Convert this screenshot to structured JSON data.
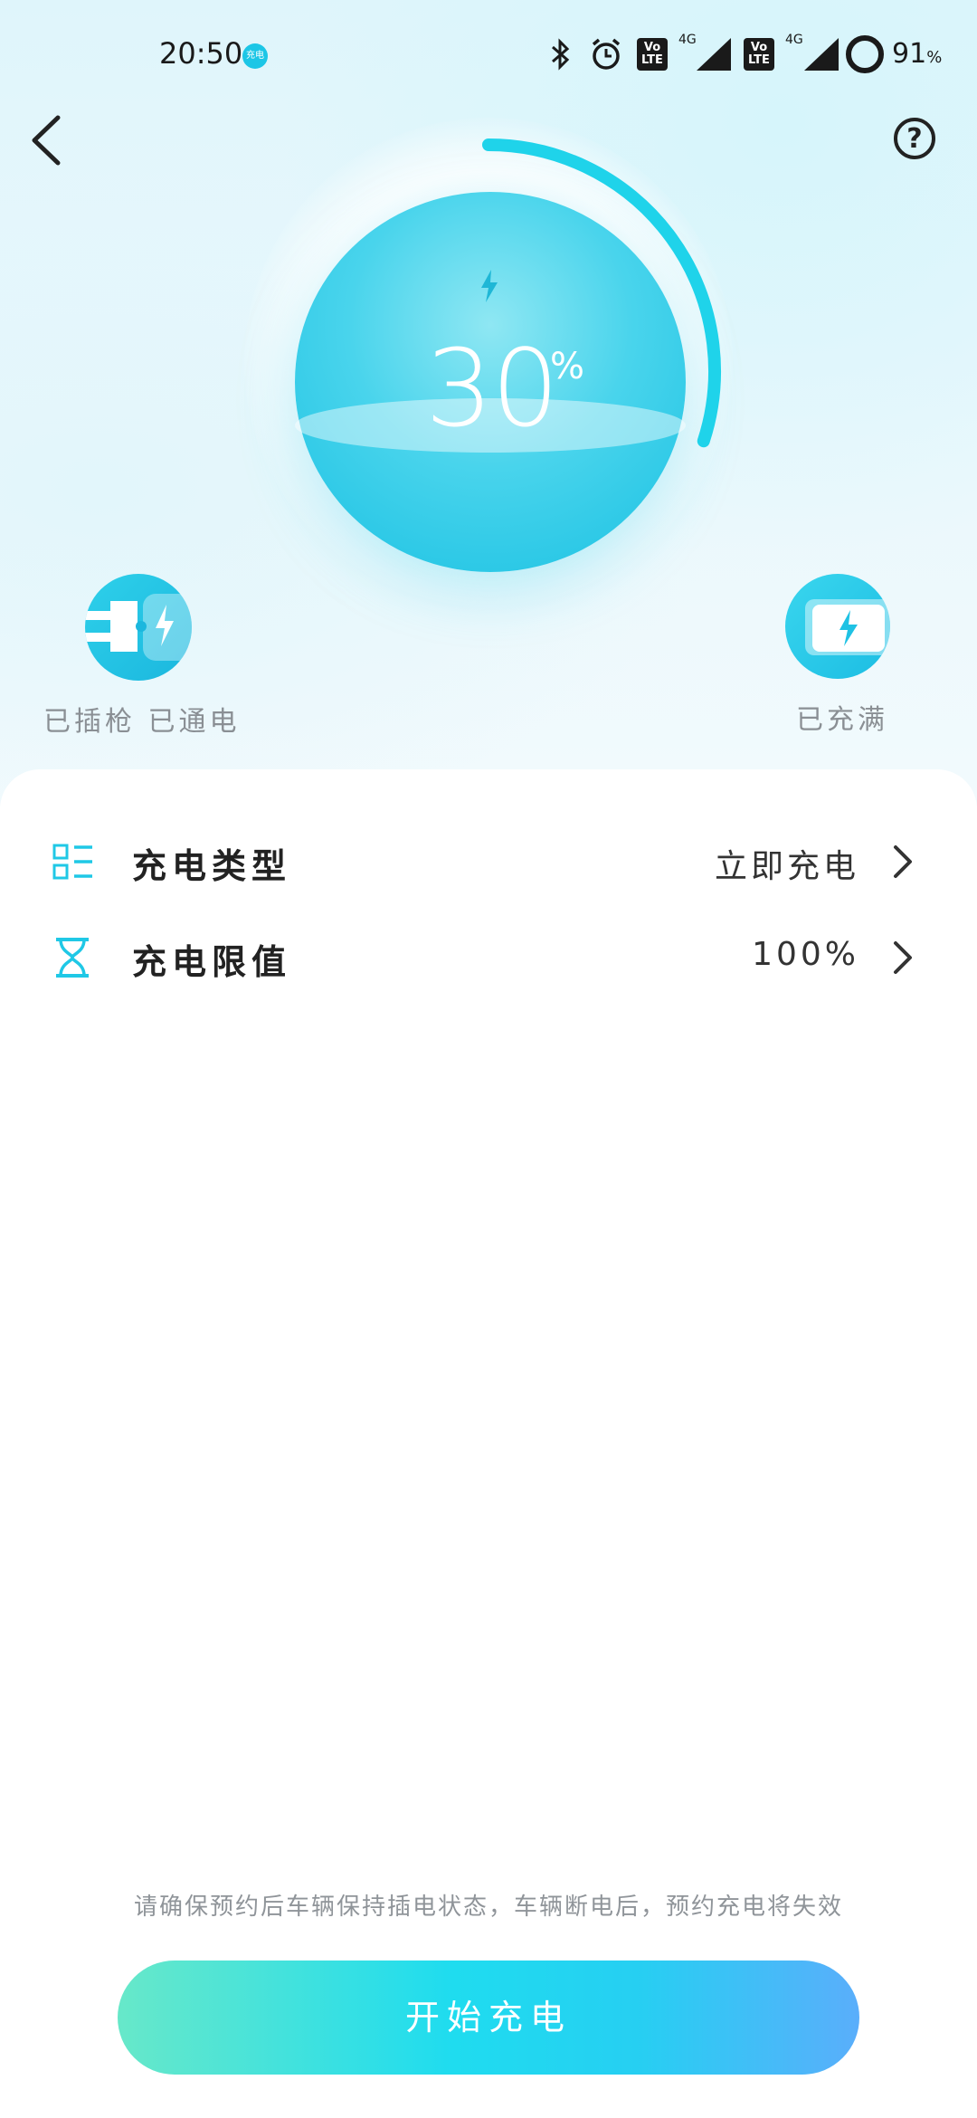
{
  "status_bar": {
    "time": "20:50",
    "app_badge": "充电",
    "lte_label_1": "Vo LTE",
    "lte_label_2": "Vo LTE",
    "net_label_1": "4G",
    "net_label_2": "4G",
    "battery": "91",
    "battery_unit": "%"
  },
  "gauge": {
    "percent_value": "30",
    "percent_sign": "%",
    "progress": 0.3
  },
  "status": {
    "plug_text": "已插枪 已通电",
    "full_text": "已充满"
  },
  "settings": [
    {
      "label": "充电类型",
      "value": "立即充电",
      "icon": "list-icon"
    },
    {
      "label": "充电限值",
      "value": "100%",
      "icon": "hourglass-icon"
    }
  ],
  "notice": "请确保预约后车辆保持插电状态，车辆断电后，预约充电将失效",
  "start_button": "开始充电",
  "colors": {
    "accent": "#1fd3ea",
    "text_primary": "#222222",
    "text_secondary": "#8a8f94"
  }
}
